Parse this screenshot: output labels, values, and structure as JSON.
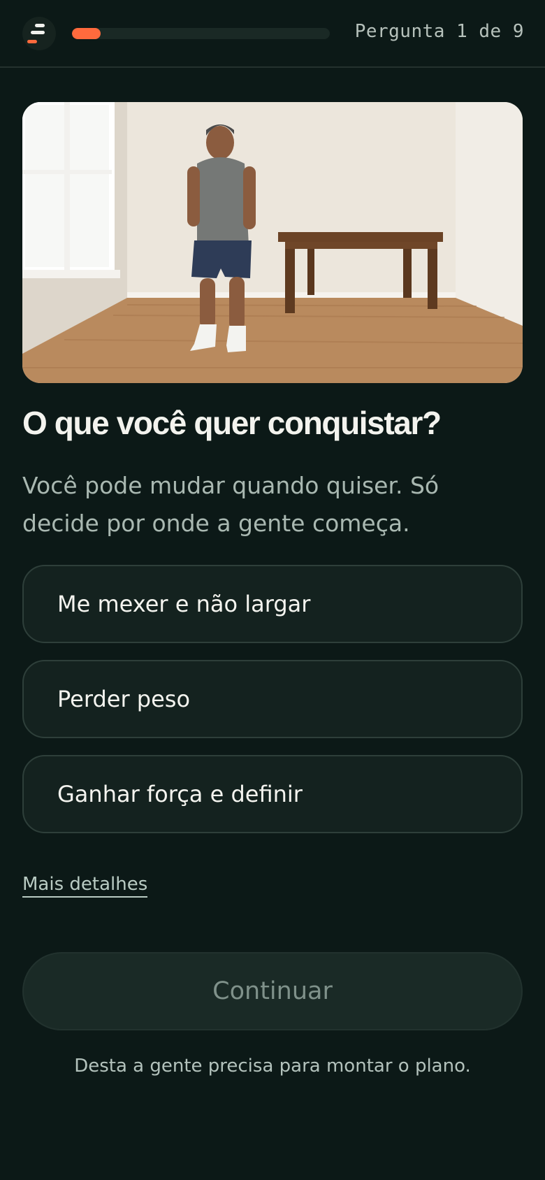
{
  "header": {
    "logo_icon": "app-logo-icon",
    "progress": {
      "current": 1,
      "total": 9,
      "fraction": 0.111,
      "fill_color": "#ff6a3d"
    },
    "step_label": "Pergunta 1 de 9"
  },
  "hero": {
    "alt_description_icon": "hero-photo"
  },
  "question": {
    "title": "O que você quer conquistar?",
    "subtitle": "Você pode mudar quando quiser. Só decide por onde a gente começa."
  },
  "options": [
    {
      "label": "Me mexer e não largar"
    },
    {
      "label": "Perder peso"
    },
    {
      "label": "Ganhar força e definir"
    }
  ],
  "details_link": "Mais detalhes",
  "continue_button": "Continuar",
  "footnote": "Desta a gente precisa para montar o plano.",
  "colors": {
    "background": "#0c1917",
    "accent": "#ff6a3d",
    "option_bg": "#14221f",
    "option_border": "#2e3f3a"
  }
}
